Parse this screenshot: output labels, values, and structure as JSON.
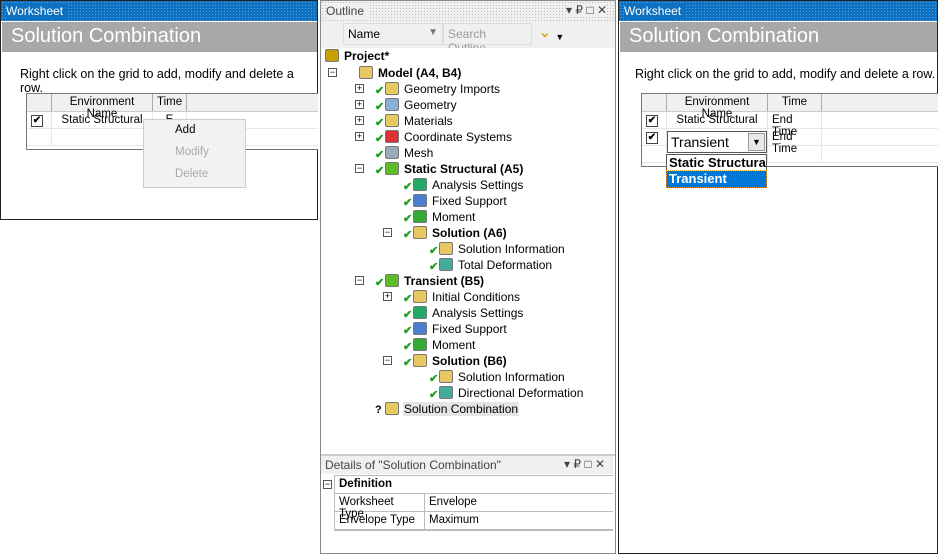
{
  "left_panel": {
    "title": "Worksheet",
    "header": "Solution Combination",
    "hint": "Right click on the grid to add, modify and delete a row.",
    "columns": [
      "Environment Name",
      "Time"
    ],
    "rows": [
      {
        "checked": true,
        "env": "Static Structural",
        "time": "E"
      }
    ],
    "context_menu": [
      {
        "label": "Add",
        "enabled": true
      },
      {
        "label": "Modify",
        "enabled": false
      },
      {
        "label": "Delete",
        "enabled": false
      }
    ]
  },
  "outline": {
    "title": "Outline",
    "filter_select": "Name",
    "search_placeholder": "Search Outline",
    "tree": [
      {
        "label": "Project*",
        "level": 0,
        "bold": true,
        "icon": "project-icon"
      },
      {
        "label": "Model (A4, B4)",
        "level": 1,
        "bold": true,
        "icon": "model-icon",
        "expander": "-"
      },
      {
        "label": "Geometry Imports",
        "level": 2,
        "icon": "geometry-imports-icon",
        "expander": "+",
        "check": true
      },
      {
        "label": "Geometry",
        "level": 2,
        "icon": "geometry-icon",
        "expander": "+",
        "check": true
      },
      {
        "label": "Materials",
        "level": 2,
        "icon": "materials-icon",
        "expander": "+",
        "check": true
      },
      {
        "label": "Coordinate Systems",
        "level": 2,
        "icon": "coordinate-systems-icon",
        "expander": "+",
        "check": true
      },
      {
        "label": "Mesh",
        "level": 2,
        "icon": "mesh-icon",
        "check": true
      },
      {
        "label": "Static Structural (A5)",
        "level": 2,
        "bold": true,
        "icon": "static-structural-icon",
        "expander": "-",
        "check": true
      },
      {
        "label": "Analysis Settings",
        "level": 3,
        "icon": "analysis-settings-icon",
        "check": true
      },
      {
        "label": "Fixed Support",
        "level": 3,
        "icon": "fixed-support-icon",
        "check": true
      },
      {
        "label": "Moment",
        "level": 3,
        "icon": "moment-icon",
        "check": true
      },
      {
        "label": "Solution (A6)",
        "level": 3,
        "bold": true,
        "icon": "solution-icon",
        "expander": "-",
        "check": true
      },
      {
        "label": "Solution Information",
        "level": 4,
        "icon": "solution-information-icon",
        "check": true
      },
      {
        "label": "Total Deformation",
        "level": 4,
        "icon": "deformation-icon",
        "check": true
      },
      {
        "label": "Transient (B5)",
        "level": 2,
        "bold": true,
        "icon": "transient-icon",
        "expander": "-",
        "check": true
      },
      {
        "label": "Initial Conditions",
        "level": 3,
        "icon": "initial-conditions-icon",
        "expander": "+",
        "check": true
      },
      {
        "label": "Analysis Settings",
        "level": 3,
        "icon": "analysis-settings-icon",
        "check": true
      },
      {
        "label": "Fixed Support",
        "level": 3,
        "icon": "fixed-support-icon",
        "check": true
      },
      {
        "label": "Moment",
        "level": 3,
        "icon": "moment-icon",
        "check": true
      },
      {
        "label": "Solution (B6)",
        "level": 3,
        "bold": true,
        "icon": "solution-icon",
        "expander": "-",
        "check": true
      },
      {
        "label": "Solution Information",
        "level": 4,
        "icon": "solution-information-icon",
        "check": true
      },
      {
        "label": "Directional Deformation",
        "level": 4,
        "icon": "deformation-icon",
        "check": true
      },
      {
        "label": "Solution Combination",
        "level": 2,
        "icon": "solution-combination-icon",
        "question": true,
        "selected": true
      }
    ]
  },
  "details": {
    "title": "Details of \"Solution Combination\"",
    "group": "Definition",
    "rows": [
      {
        "label": "Worksheet Type",
        "value": "Envelope"
      },
      {
        "label": "Envelope Type",
        "value": "Maximum"
      }
    ]
  },
  "right_panel": {
    "title": "Worksheet",
    "header": "Solution Combination",
    "hint": "Right click on the grid to add, modify and delete a row.",
    "columns": [
      "Environment Name",
      "Time"
    ],
    "rows": [
      {
        "checked": true,
        "env": "Static Structural",
        "time": "End Time"
      },
      {
        "checked": true,
        "env": "Transient",
        "time": "End Time"
      }
    ],
    "dropdown_options": [
      "Static Structural",
      "Transient"
    ],
    "dropdown_selected": "Transient"
  },
  "colors": {
    "titlebar": "#0e70c0",
    "header": "#a8a8a8",
    "selection": "#0078d7"
  }
}
